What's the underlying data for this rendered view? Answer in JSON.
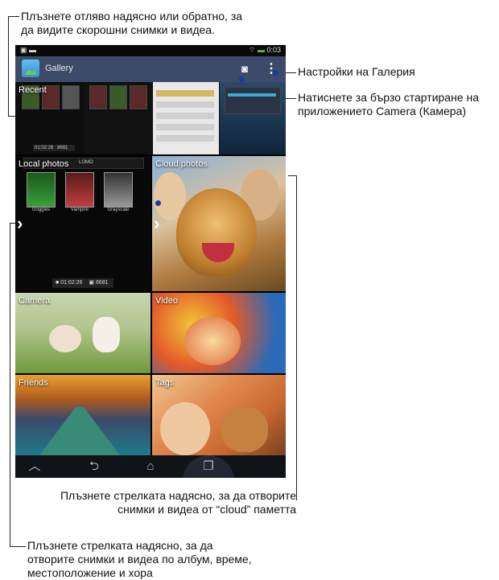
{
  "callouts": {
    "top_left_line1": "Плъзнете отляво надясно или обратно, за",
    "top_left_line2": "да видите скорошни снимки и видеа.",
    "settings": "Настройки на Галерия",
    "camera_line1": "Натиснете за бързо стартиране на",
    "camera_line2": "приложението Camera (Камера)",
    "cloud_line1": "Плъзнете стрелката надясно, за да отворите",
    "cloud_line2": "снимки и видеа от  “cloud” паметта",
    "album_line1": "Плъзнете стрелката надясно, за да",
    "album_line2": "отворите снимки и видеа по албум, време,",
    "album_line3": "местоположение и хора"
  },
  "status_bar": {
    "time": "0:03"
  },
  "app": {
    "title": "Gallery"
  },
  "tiles": {
    "recent": "Recent",
    "local_photos": "Local photos",
    "cloud_photos": "Cloud photos",
    "camera": "Camera",
    "video": "Video",
    "friends": "Friends",
    "tags": "Tags"
  },
  "local_info": {
    "duration": "01:02:26",
    "count": "8681"
  },
  "recent_info": {
    "duration": "01:02:26",
    "count": "8681"
  },
  "effects": [
    "Goggles",
    "Vampire",
    "Grayscale"
  ],
  "effect_top": "LOMO",
  "icons": {
    "camera": "camera-icon",
    "menu": "overflow-menu-icon",
    "nav_hide": "hide-keyboard-icon",
    "nav_back": "back-icon",
    "nav_home": "home-icon",
    "nav_recent": "recent-apps-icon",
    "arrow": "chevron-right-icon"
  }
}
